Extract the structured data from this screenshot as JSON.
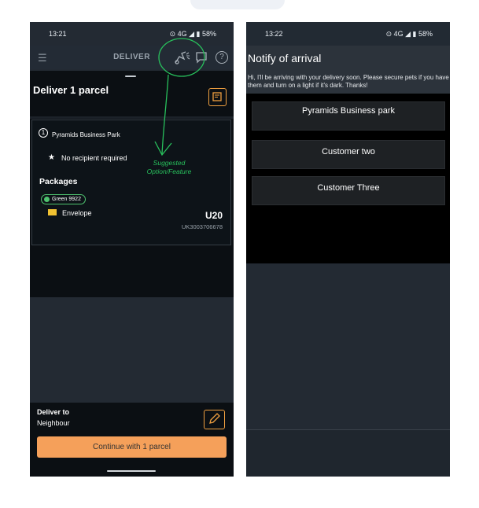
{
  "left_phone": {
    "status": {
      "time": "13:21",
      "right": "⊙ 4G ◢ ▮ 58%"
    },
    "appbar": {
      "title": "DELIVER"
    },
    "sheet": {
      "title": "Deliver 1 parcel"
    },
    "stop": {
      "number": "1",
      "name": "Pyramids Business Park",
      "recipient": "No recipient required"
    },
    "packages": {
      "heading": "Packages",
      "tag": "Green 9922",
      "type": "Envelope",
      "code": "U20",
      "tracking": "UK3003706678"
    },
    "annotation": {
      "line1": "Suggested",
      "line2": "Option/Feature"
    },
    "footer": {
      "deliver_to_label": "Deliver to",
      "deliver_to_value": "Neighbour",
      "continue_label": "Continue with 1 parcel"
    }
  },
  "right_phone": {
    "status": {
      "time": "13:22",
      "right": "⊙ 4G ◢ ▮ 58%"
    },
    "title": "Notify of arrival",
    "message": "Hi, I'll be arriving with your delivery soon. Please secure pets if you have them and turn on a light if it's dark. Thanks!",
    "recipients": [
      "Pyramids Business park",
      "Customer  two",
      "Customer Three"
    ]
  },
  "colors": {
    "accent_orange": "#f5a05a",
    "annotation_green": "#28c05c",
    "tag_green": "#4fc36f"
  }
}
